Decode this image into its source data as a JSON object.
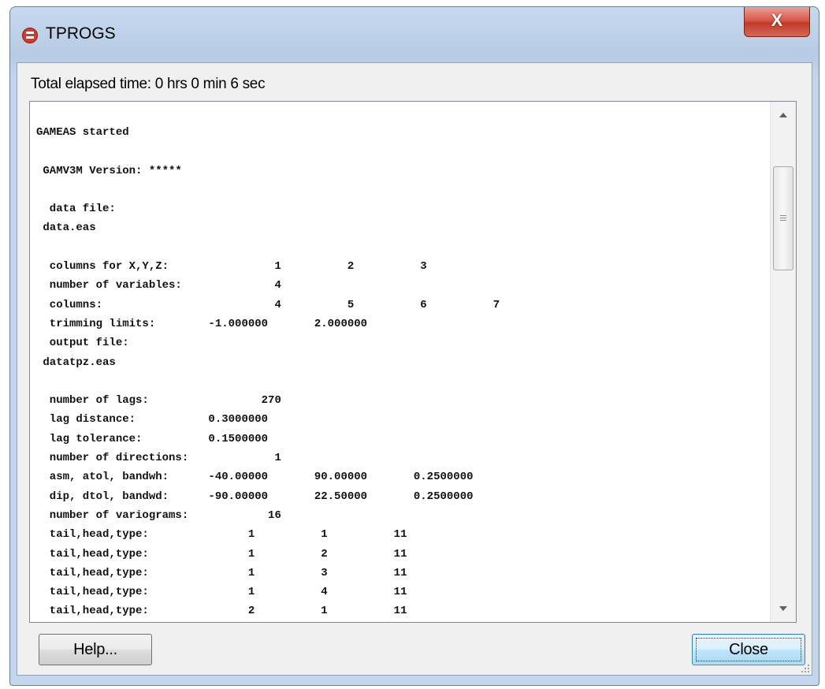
{
  "window": {
    "title": "TPROGS",
    "close_glyph": "X",
    "icon": "tprogs-app-icon"
  },
  "status": {
    "elapsed": "Total elapsed time: 0 hrs 0 min 6 sec"
  },
  "log": {
    "lines": [
      "GAMEAS started",
      "",
      " GAMV3M Version: *****",
      "",
      "  data file:",
      " data.eas",
      "",
      "  columns for X,Y,Z:                1          2          3",
      "  number of variables:              4",
      "  columns:                          4          5          6          7",
      "  trimming limits:        -1.000000       2.000000",
      "  output file:",
      " datatpz.eas",
      "",
      "  number of lags:                 270",
      "  lag distance:           0.3000000",
      "  lag tolerance:          0.1500000",
      "  number of directions:             1",
      "  asm, atol, bandwh:      -40.00000       90.00000       0.2500000",
      "  dip, dtol, bandwd:      -90.00000       22.50000       0.2500000",
      "  number of variograms:            16",
      "  tail,head,type:               1          1          11",
      "  tail,head,type:               1          2          11",
      "  tail,head,type:               1          3          11",
      "  tail,head,type:               1          4          11",
      "  tail,head,type:               2          1          11"
    ]
  },
  "buttons": {
    "help": "Help...",
    "close": "Close"
  },
  "colors": {
    "title_gradient": "#c7d9ee",
    "close_button": "#c23a2a",
    "default_button": "#bee6fd"
  }
}
